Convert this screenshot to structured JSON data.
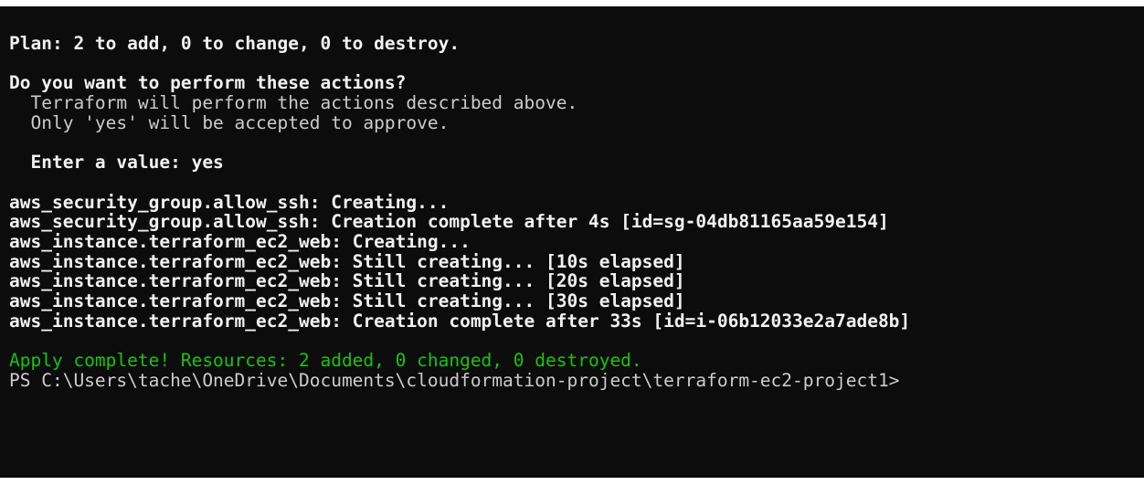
{
  "terminal": {
    "colors": {
      "background": "#0c0c0c",
      "text": "#cccccc",
      "bold_text": "#f2f2f2",
      "success": "#16c60c"
    },
    "lines": [
      {
        "text": "Plan: 2 to add, 0 to change, 0 to destroy.",
        "style": "bold"
      },
      {
        "text": "",
        "style": "plain"
      },
      {
        "text": "Do you want to perform these actions?",
        "style": "bold"
      },
      {
        "text": "  Terraform will perform the actions described above.",
        "style": "plain"
      },
      {
        "text": "  Only 'yes' will be accepted to approve.",
        "style": "plain"
      },
      {
        "text": "",
        "style": "plain"
      },
      {
        "text": "  Enter a value: yes",
        "style": "bold"
      },
      {
        "text": "",
        "style": "plain"
      },
      {
        "text": "aws_security_group.allow_ssh: Creating...",
        "style": "bold"
      },
      {
        "text": "aws_security_group.allow_ssh: Creation complete after 4s [id=sg-04db81165aa59e154]",
        "style": "bold"
      },
      {
        "text": "aws_instance.terraform_ec2_web: Creating...",
        "style": "bold"
      },
      {
        "text": "aws_instance.terraform_ec2_web: Still creating... [10s elapsed]",
        "style": "bold"
      },
      {
        "text": "aws_instance.terraform_ec2_web: Still creating... [20s elapsed]",
        "style": "bold"
      },
      {
        "text": "aws_instance.terraform_ec2_web: Still creating... [30s elapsed]",
        "style": "bold"
      },
      {
        "text": "aws_instance.terraform_ec2_web: Creation complete after 33s [id=i-06b12033e2a7ade8b]",
        "style": "bold"
      },
      {
        "text": "",
        "style": "plain"
      },
      {
        "text": "Apply complete! Resources: 2 added, 0 changed, 0 destroyed.",
        "style": "green"
      },
      {
        "text": "PS C:\\Users\\tache\\OneDrive\\Documents\\cloudformation-project\\terraform-ec2-project1>",
        "style": "plain"
      }
    ]
  }
}
